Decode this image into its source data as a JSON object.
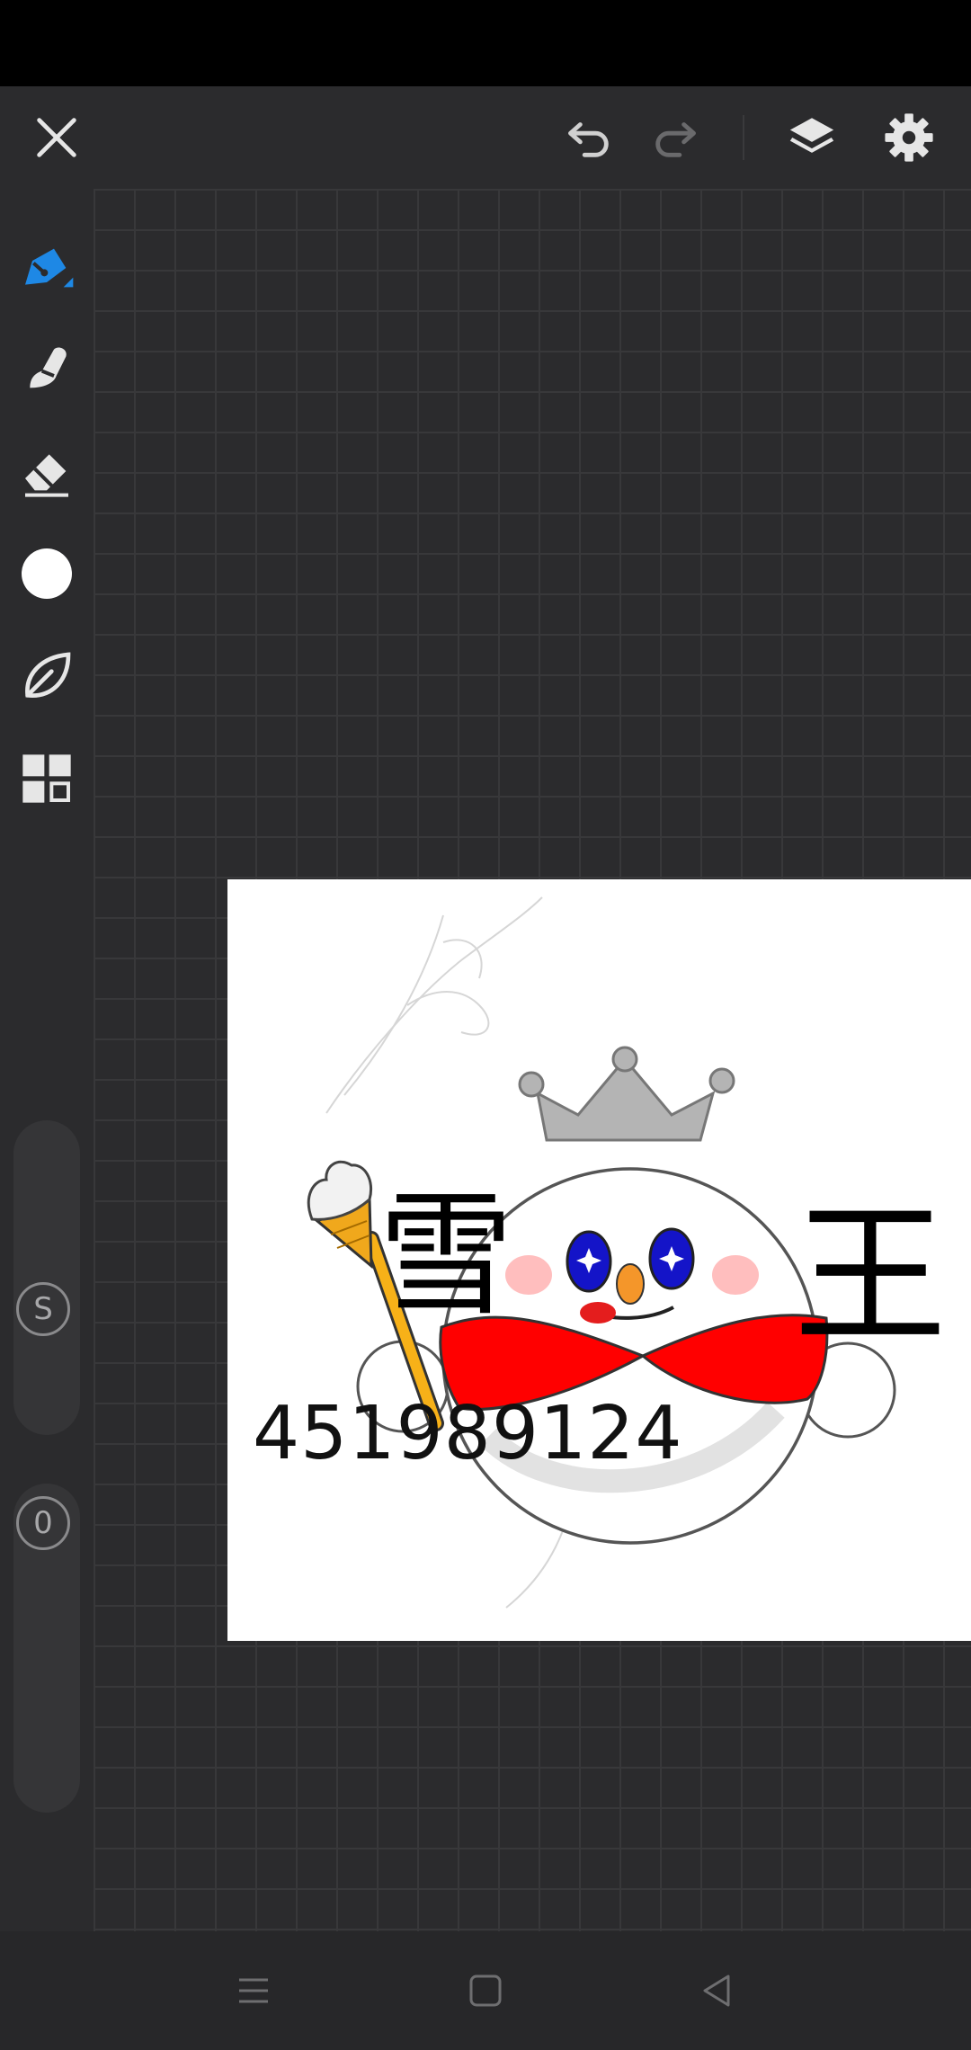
{
  "canvas": {
    "number_text": "451989124",
    "chars": {
      "left": "雪",
      "right": "王"
    }
  },
  "toolbar": {
    "tools": [
      "pen-icon",
      "smudge-icon",
      "eraser-icon",
      "color-swatch",
      "leaf-brush-icon",
      "grid-icon"
    ],
    "size_slider_label": "S",
    "opacity_slider_label": "0"
  },
  "colors": {
    "accent": "#1e88e5",
    "background": "#2b2b2d",
    "current_color": "#ffffff"
  }
}
